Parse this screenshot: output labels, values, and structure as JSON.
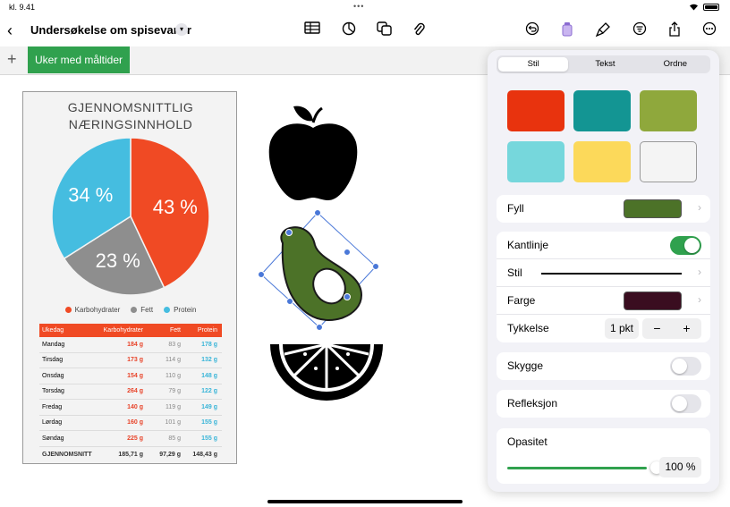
{
  "status": {
    "time": "kl. 9.41",
    "dots": "•••"
  },
  "toolbar": {
    "back_icon": "chevron-left-icon",
    "title": "Undersøkelse om spisevaner",
    "title_chevron": "chevron-down-icon",
    "icons": [
      "table-icon",
      "chart-icon",
      "shapes-icon",
      "paperclip-icon",
      "undo-icon",
      "format-brush-icon",
      "format-icon",
      "organize-icon",
      "share-icon",
      "more-icon"
    ]
  },
  "sheets": {
    "add_label": "+",
    "tabs": [
      {
        "label": "Uker med måltider"
      }
    ]
  },
  "chart_data": {
    "type": "pie",
    "title": "GJENNOMSNITTLIG NÆRINGSINNHOLD",
    "slices": [
      {
        "name": "Karbohydrater",
        "value": 43,
        "label": "43 %",
        "color": "#f04a24"
      },
      {
        "name": "Fett",
        "value": 23,
        "label": "23 %",
        "color": "#8e8e8e"
      },
      {
        "name": "Protein",
        "value": 34,
        "label": "34 %",
        "color": "#45bde0"
      }
    ],
    "legend_position": "bottom"
  },
  "table": {
    "headers": [
      "Ukedag",
      "Karbohydrater",
      "Fett",
      "Protein"
    ],
    "rows": [
      [
        "Mandag",
        "184 g",
        "83 g",
        "178 g"
      ],
      [
        "Tirsdag",
        "173 g",
        "114 g",
        "132 g"
      ],
      [
        "Onsdag",
        "154 g",
        "110 g",
        "148 g"
      ],
      [
        "Torsdag",
        "264 g",
        "79 g",
        "122 g"
      ],
      [
        "Fredag",
        "140 g",
        "119 g",
        "149 g"
      ],
      [
        "Lørdag",
        "160 g",
        "101 g",
        "155 g"
      ],
      [
        "Søndag",
        "225 g",
        "85 g",
        "155 g"
      ]
    ],
    "total": [
      "GJENNOMSNITT",
      "185,71 g",
      "97,29 g",
      "148,43 g"
    ]
  },
  "images": {
    "apple": "apple-icon",
    "avocado": "avocado-icon",
    "citrus": "citrus-slice-icon"
  },
  "panel": {
    "tabs": [
      "Stil",
      "Tekst",
      "Ordne"
    ],
    "active_tab": "Stil",
    "style_swatches": [
      "#e8330e",
      "#139593",
      "#8fa83c",
      "#76d7dc",
      "#fcd95a",
      "#f4f4f4"
    ],
    "fill": {
      "label": "Fyll",
      "color": "#4c7228"
    },
    "border": {
      "label": "Kantlinje",
      "enabled": true,
      "style_label": "Stil",
      "color_label": "Farge",
      "color": "#3a0d20",
      "thickness_label": "Tykkelse",
      "thickness_value": "1 pkt",
      "minus": "−",
      "plus": "+"
    },
    "shadow": {
      "label": "Skygge",
      "enabled": false
    },
    "reflection": {
      "label": "Refleksjon",
      "enabled": false
    },
    "opacity": {
      "label": "Opasitet",
      "value": "100 %",
      "fraction": 1.0
    }
  }
}
